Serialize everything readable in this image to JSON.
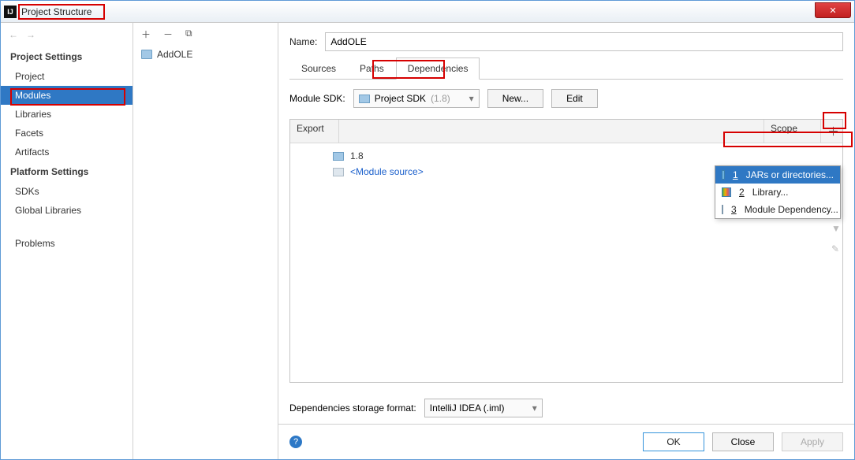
{
  "window": {
    "title": "Project Structure"
  },
  "sidebar": {
    "sections": [
      {
        "label": "Project Settings",
        "items": [
          "Project",
          "Modules",
          "Libraries",
          "Facets",
          "Artifacts"
        ],
        "selected": 1
      },
      {
        "label": "Platform Settings",
        "items": [
          "SDKs",
          "Global Libraries"
        ]
      }
    ],
    "extra": "Problems"
  },
  "modules": {
    "list": [
      "AddOLE"
    ]
  },
  "main": {
    "nameLabel": "Name:",
    "nameValue": "AddOLE",
    "tabs": [
      "Sources",
      "Paths",
      "Dependencies"
    ],
    "activeTab": 2,
    "sdkLabel": "Module SDK:",
    "sdkValue": "Project SDK",
    "sdkVersion": "(1.8)",
    "newBtn": "New...",
    "editBtn": "Edit",
    "headers": {
      "export": "Export",
      "scope": "Scope"
    },
    "deps": [
      {
        "label": "1.8",
        "kind": "jdk"
      },
      {
        "label": "<Module source>",
        "kind": "ms"
      }
    ],
    "popup": [
      {
        "n": "1",
        "label": "JARs or directories..."
      },
      {
        "n": "2",
        "label": "Library..."
      },
      {
        "n": "3",
        "label": "Module Dependency..."
      }
    ],
    "storageLabel": "Dependencies storage format:",
    "storageValue": "IntelliJ IDEA (.iml)"
  },
  "footer": {
    "ok": "OK",
    "cancel": "Close",
    "apply": "Apply"
  }
}
